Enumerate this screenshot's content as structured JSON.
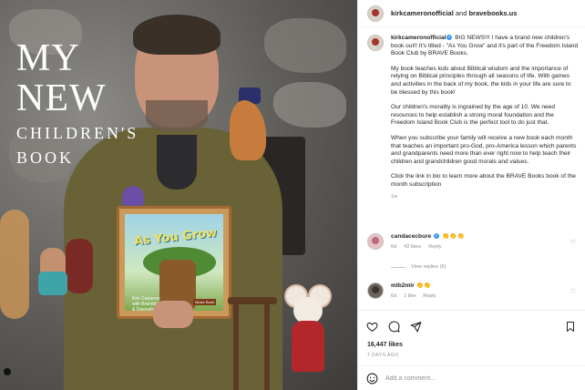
{
  "post_image": {
    "headline_line1": "MY",
    "headline_line2": "NEW",
    "headline_line3": "CHILDREN'S",
    "headline_line4": "BOOK",
    "book_title": "As You Grow",
    "book_author": "Kirk Cameron\nwith Brandon Graves\n& Dawnelle Tibbs",
    "book_badge": "Brave Book"
  },
  "header": {
    "user1": "kirkcameronofficial",
    "joiner": " and ",
    "user2": "bravebooks.us"
  },
  "caption": {
    "username": "kirkcameronofficial",
    "intro": " BIG NEWS!!!  I have a brand new children's book out!! It's titled - \"As You Grow\" and it's part of the Freedom Island Book Club by BRAVE Books.",
    "p2": "My book teaches kids about Biblical wisdom and the importance of relying on Biblical principles through all seasons of life. With games and activities in the back of my book, the kids in your life are sure to be blessed by this book!",
    "p3": "Our children's morality is ingrained by the age of 10. We need resources to help establish a strong moral foundation and the Freedom Island Book Club is the perfect tool to do just that.",
    "p4": "When you subscribe your family will receive a new book each month that teaches an important pro-God, pro-America lesson which parents and grandparents need more than ever right now to help teach their children and grandchildren good morals and values.",
    "p5": "Click the link in bio to learn more about the BRAVE Books book of the month subscription",
    "time": "1w"
  },
  "comments": [
    {
      "username": "candacecbure",
      "text": "👏👏👏",
      "time": "6d",
      "likes": "42 likes",
      "reply": "Reply"
    },
    {
      "username": "mlb2mlr",
      "text": "👏👏",
      "time": "6d",
      "likes": "1 like",
      "reply": "Reply"
    }
  ],
  "view_replies": "View replies (5)",
  "actions": {
    "likes": "16,447 likes",
    "ago": "7 DAYS AGO",
    "comment_placeholder": "Add a comment..."
  },
  "icons": {
    "like": "heart-icon",
    "comment": "comment-icon",
    "share": "share-icon",
    "save": "bookmark-icon",
    "emoji": "emoji-icon"
  },
  "colors": {
    "verified": "#3897f0",
    "muted_text": "#8e8e8e",
    "text": "#262626"
  }
}
